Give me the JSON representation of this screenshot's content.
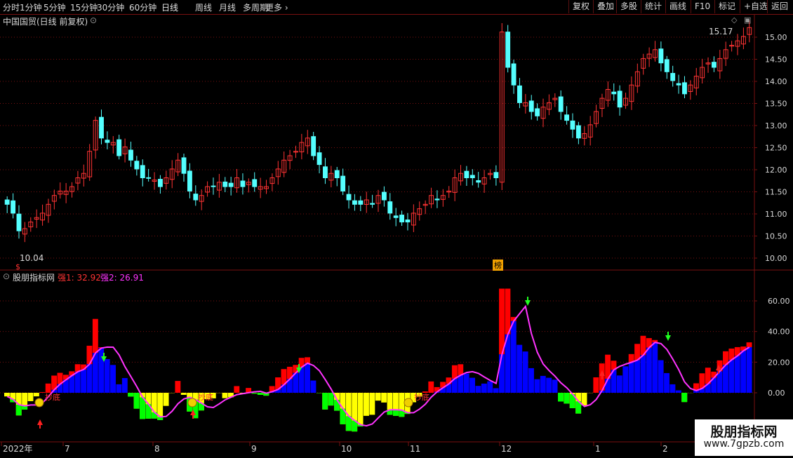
{
  "toolbar": {
    "left_items": [
      "分时",
      "1分钟",
      "5分钟",
      "15分钟",
      "30分钟",
      "60分钟",
      "日线",
      "周线",
      "月线",
      "多周期",
      "更多"
    ],
    "active": "日线",
    "right_items": [
      "复权",
      "叠加",
      "多股",
      "统计",
      "画线",
      "F10",
      "标记",
      "+自选",
      "返回"
    ]
  },
  "main_chart": {
    "title": "中国国贸(日线 前复权)",
    "price_axis": [
      "15.00",
      "14.50",
      "14.00",
      "13.50",
      "13.00",
      "12.50",
      "12.00",
      "11.50",
      "11.00",
      "10.50",
      "10.00"
    ],
    "high_label": "15.17",
    "low_label": "10.04",
    "badge_bang": "榜",
    "badge_dollar": "$"
  },
  "indicator": {
    "title": "股朋指标网",
    "line1_label": "强1: 32.92",
    "line2_label": "强2: 26.91",
    "axis": [
      "60.00",
      "40.00",
      "20.00",
      "0.00"
    ],
    "signal_text": "抄底"
  },
  "date_axis": [
    "2022年",
    "7",
    "8",
    "9",
    "10",
    "11",
    "12",
    "1",
    "2"
  ],
  "watermark": {
    "line1": "股朋指标网",
    "line2": "www.7gpzb.com"
  },
  "colors": {
    "up": "#ff3333",
    "down": "#54ffff",
    "grid": "#7a1010",
    "blue_bar": "#0000ff",
    "yellow_bar": "#ffff00",
    "green_bar": "#00ff00",
    "red_bar": "#ff0000",
    "magenta_line": "#ff33ff"
  },
  "chart_data": {
    "type": "candlestick",
    "title": "中国国贸(日线 前复权)",
    "ylim": [
      10.0,
      15.2
    ],
    "closes": [
      10.9,
      10.7,
      10.3,
      10.35,
      10.5,
      10.6,
      10.7,
      10.9,
      11.1,
      11.2,
      11.2,
      11.3,
      11.5,
      11.6,
      12.1,
      12.8,
      12.4,
      12.3,
      12.3,
      12.0,
      12.2,
      11.9,
      11.7,
      11.5,
      11.5,
      11.45,
      11.3,
      11.5,
      11.7,
      11.9,
      11.6,
      11.2,
      11.0,
      11.1,
      11.3,
      11.3,
      11.4,
      11.3,
      11.3,
      11.5,
      11.3,
      11.4,
      11.3,
      11.3,
      11.3,
      11.5,
      11.7,
      11.9,
      12.0,
      12.1,
      12.3,
      12.4,
      12.0,
      11.8,
      11.5,
      11.6,
      11.5,
      11.2,
      11.0,
      10.9,
      10.9,
      11.0,
      10.9,
      11.1,
      11.0,
      10.7,
      10.6,
      10.5,
      10.5,
      10.7,
      10.8,
      10.9,
      11.1,
      11.0,
      11.1,
      11.2,
      11.5,
      11.6,
      11.5,
      11.5,
      11.4,
      11.5,
      11.6,
      11.5,
      14.8,
      14.0,
      13.6,
      13.2,
      13.2,
      13.0,
      12.9,
      13.1,
      13.2,
      13.3,
      13.0,
      12.8,
      12.6,
      12.4,
      12.5,
      12.7,
      13.0,
      13.3,
      13.5,
      13.4,
      13.1,
      13.3,
      13.6,
      13.9,
      14.2,
      14.3,
      14.4,
      14.1,
      13.9,
      13.7,
      13.6,
      13.4,
      13.6,
      13.8,
      14.0,
      14.1,
      14.0,
      14.2,
      14.4,
      14.5,
      14.6,
      14.7,
      14.9
    ],
    "indicator": {
      "series": [
        {
          "name": "强1",
          "last": 32.92
        },
        {
          "name": "强2",
          "last": 26.91
        }
      ],
      "ylim": [
        -30,
        70
      ]
    }
  }
}
